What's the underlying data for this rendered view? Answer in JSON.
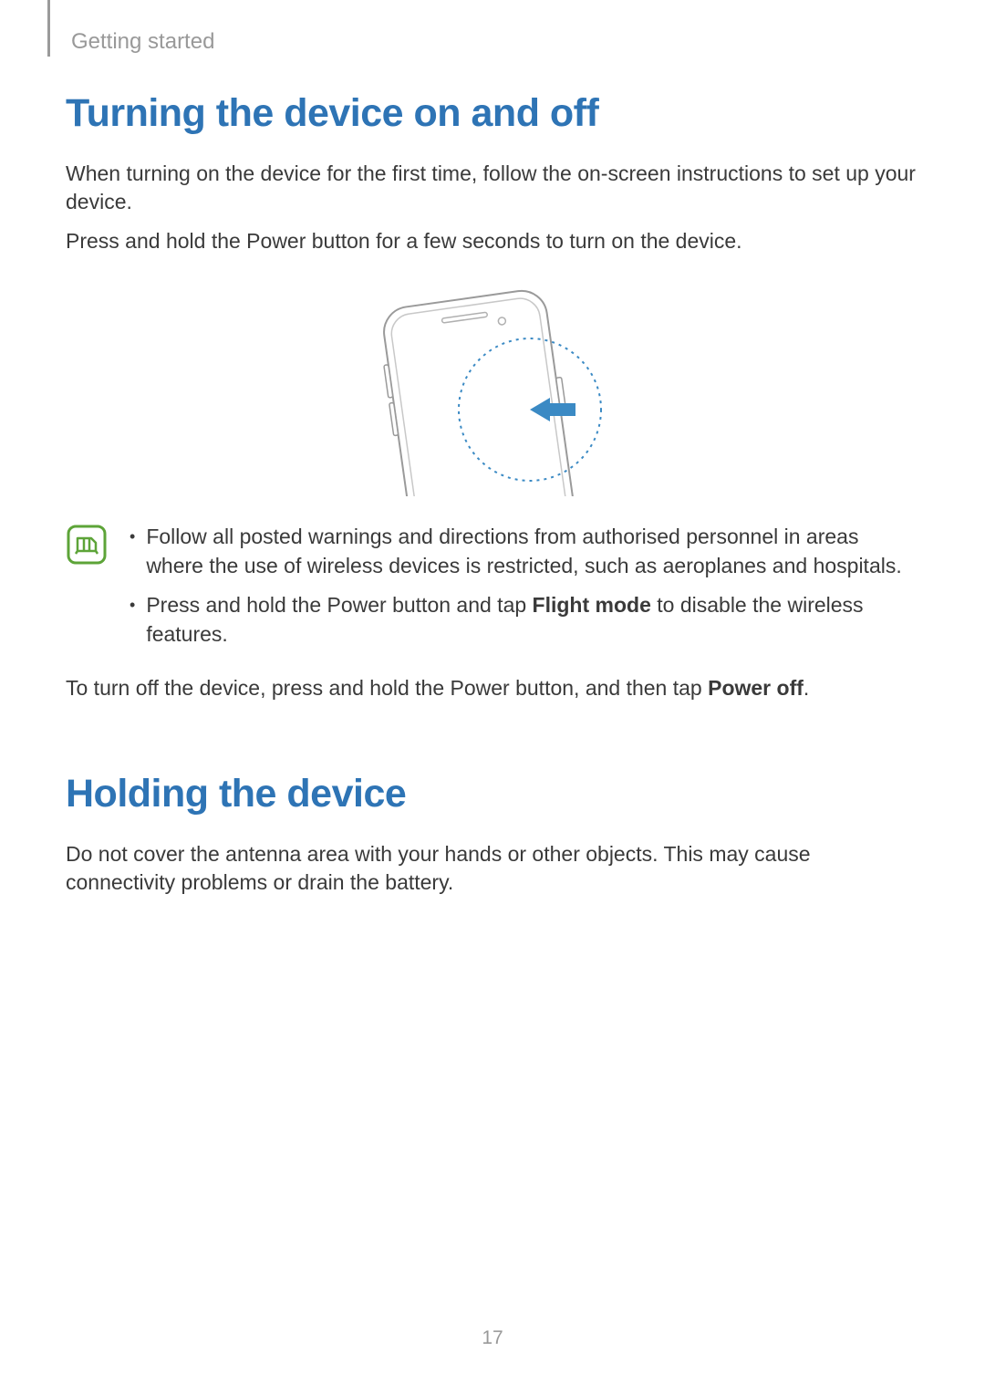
{
  "header": {
    "section_name": "Getting started"
  },
  "sections": [
    {
      "heading": "Turning the device on and off",
      "paragraphs": [
        "When turning on the device for the first time, follow the on-screen instructions to set up your device.",
        "Press and hold the Power button for a few seconds to turn on the device."
      ],
      "note_items": [
        {
          "pre": "Follow all posted warnings and directions from authorised personnel in areas where the use of wireless devices is restricted, such as aeroplanes and hospitals."
        },
        {
          "pre": "Press and hold the Power button and tap ",
          "bold": "Flight mode",
          "post": " to disable the wireless features."
        }
      ],
      "closing": {
        "pre": "To turn off the device, press and hold the Power button, and then tap ",
        "bold": "Power off",
        "post": "."
      }
    },
    {
      "heading": "Holding the device",
      "paragraphs": [
        "Do not cover the antenna area with your hands or other objects. This may cause connectivity problems or drain the battery."
      ]
    }
  ],
  "page_number": "17",
  "colors": {
    "heading_blue": "#2e74b5",
    "arrow_blue": "#3b8ac4",
    "icon_green": "#5da438"
  }
}
